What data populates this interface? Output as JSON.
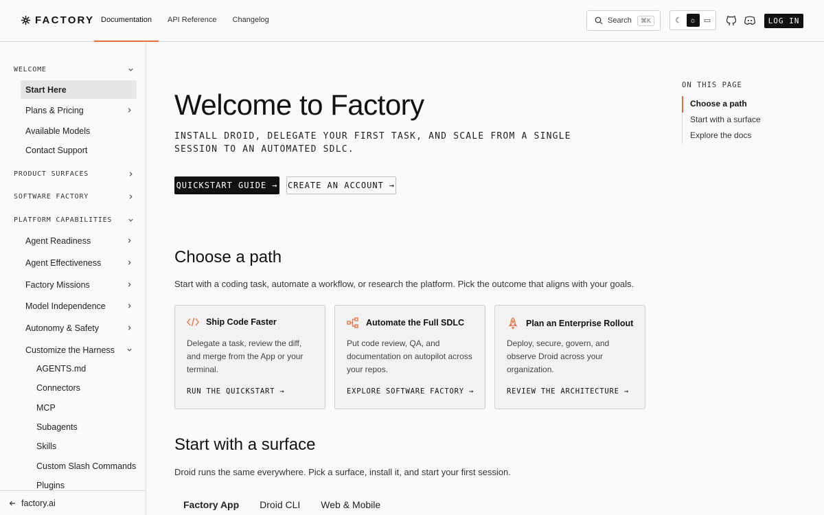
{
  "header": {
    "brand": "FACTORY",
    "nav": [
      "Documentation",
      "API Reference",
      "Changelog"
    ],
    "search_label": "Search",
    "search_shortcut": "⌘K",
    "login_label": "LOG IN",
    "accent_color": "#e5703c"
  },
  "sidebar": {
    "welcome": "WELCOME",
    "welcome_items": [
      "Start Here",
      "Plans & Pricing",
      "Available Models",
      "Contact Support"
    ],
    "product_surfaces": "PRODUCT SURFACES",
    "software_factory": "SOFTWARE FACTORY",
    "platform_capabilities": "PLATFORM CAPABILITIES",
    "platform_items": [
      "Agent Readiness",
      "Agent Effectiveness",
      "Factory Missions",
      "Model Independence",
      "Autonomy & Safety",
      "Customize the Harness"
    ],
    "harness_items": [
      "AGENTS.md",
      "Connectors",
      "MCP",
      "Subagents",
      "Skills",
      "Custom Slash Commands",
      "Plugins"
    ],
    "footer_link": "factory.ai"
  },
  "main": {
    "title": "Welcome to Factory",
    "lead": "INSTALL DROID, DELEGATE YOUR FIRST TASK, AND SCALE FROM A SINGLE SESSION TO AN AUTOMATED SDLC.",
    "primary_button": "QUICKSTART GUIDE",
    "secondary_button": "CREATE AN ACCOUNT",
    "choose_title": "Choose a path",
    "choose_text": "Start with a coding task, automate a workflow, or research the platform. Pick the outcome that aligns with your goals.",
    "cards": [
      {
        "title": "Ship Code Faster",
        "desc": "Delegate a task, review the diff, and merge from the App or your terminal.",
        "link": "RUN THE QUICKSTART",
        "icon": "code-icon"
      },
      {
        "title": "Automate the Full SDLC",
        "desc": "Put code review, QA, and documentation on autopilot across your repos.",
        "link": "EXPLORE SOFTWARE FACTORY",
        "icon": "workflow-icon"
      },
      {
        "title": "Plan an Enterprise Rollout",
        "desc": "Deploy, secure, govern, and observe Droid across your organization.",
        "link": "REVIEW THE ARCHITECTURE",
        "icon": "rocket-icon"
      }
    ],
    "surface_title": "Start with a surface",
    "surface_text": "Droid runs the same everywhere. Pick a surface, install it, and start your first session.",
    "surface_tabs": [
      "Factory App",
      "Droid CLI",
      "Web & Mobile"
    ]
  },
  "toc": {
    "title": "ON THIS PAGE",
    "items": [
      "Choose a path",
      "Start with a surface",
      "Explore the docs"
    ]
  }
}
